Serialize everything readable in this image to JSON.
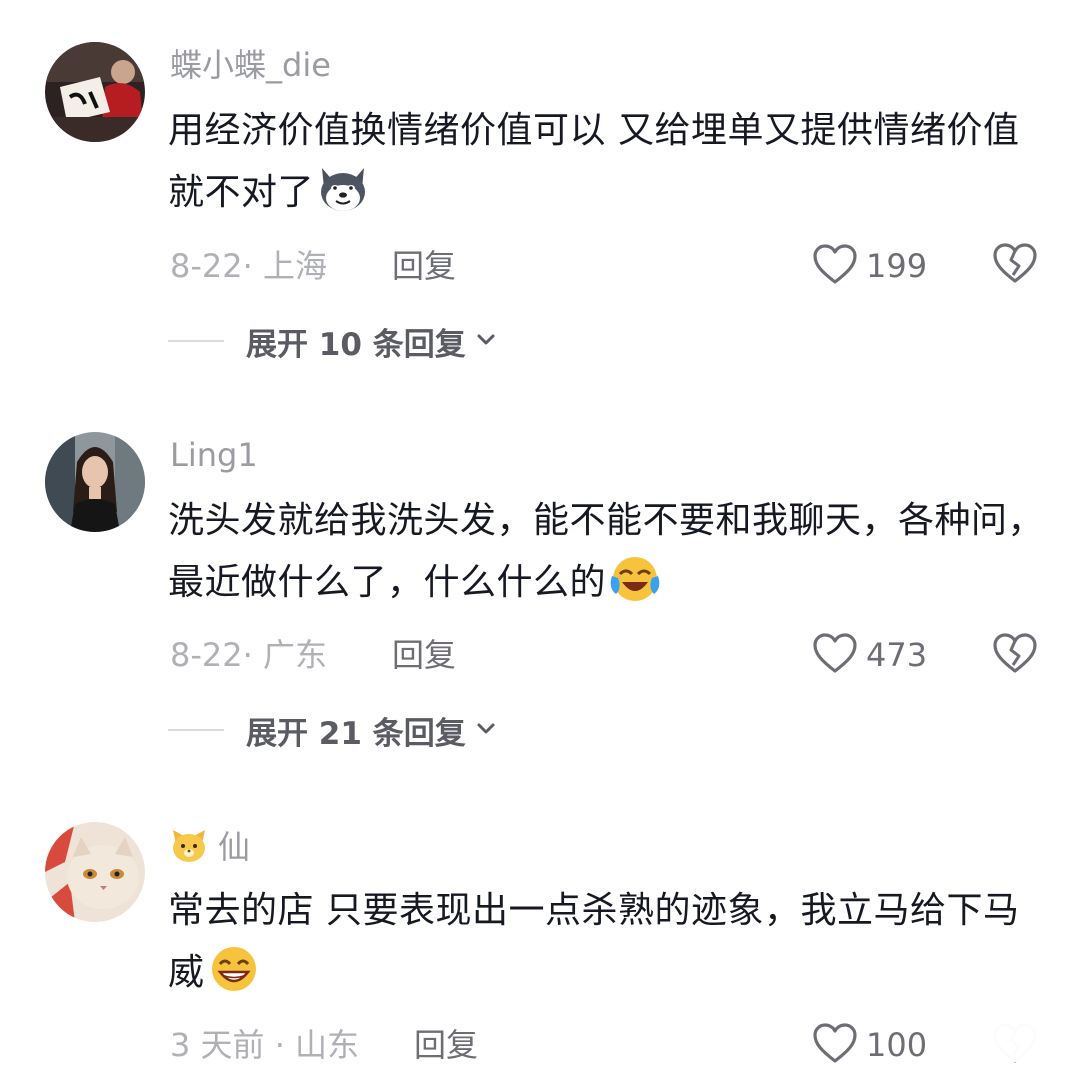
{
  "comments": [
    {
      "username": "蝶小蝶_die",
      "text": "用经济价值换情绪价值可以  又给埋单又提供情绪价值就不对了",
      "emoji": "husky-dog-emoji",
      "time_location": "8-22· 上海",
      "reply_label": "回复",
      "likes": "199",
      "expand_label": "展开 10 条回复"
    },
    {
      "username": "Ling1",
      "text": "洗头发就给我洗头发，能不能不要和我聊天，各种问，最近做什么了，什么什么的",
      "emoji": "laughing-crying-emoji",
      "time_location": "8-22· 广东",
      "reply_label": "回复",
      "likes": "473",
      "expand_label": "展开 21 条回复"
    },
    {
      "username_emoji": "cat-emoji",
      "username": "仙",
      "text": "常去的店 只要表现出一点杀熟的迹象，我立马给下马威",
      "emoji": "grinning-emoji",
      "time_location": "3 天前 · 山东",
      "reply_label": "回复",
      "likes": "100"
    }
  ],
  "colors": {
    "username": "#9b9ca2",
    "text": "#161823",
    "meta": "#b0b1b6",
    "action": "#6d6e75"
  }
}
